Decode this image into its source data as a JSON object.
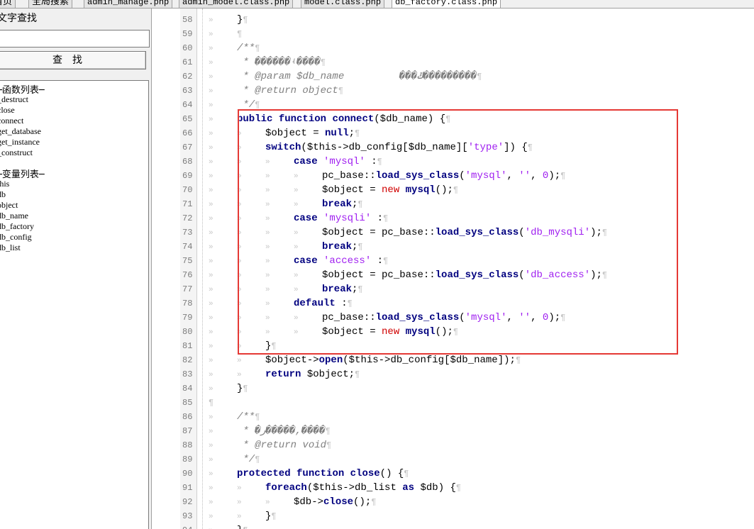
{
  "tabs": [
    {
      "label": "首页"
    },
    {
      "label": "全局搜索"
    },
    {
      "label": "admin_manage.php"
    },
    {
      "label": "admin_model.class.php"
    },
    {
      "label": "model.class.php"
    },
    {
      "label": "db_factory.class.php"
    }
  ],
  "search": {
    "title": "文字查找",
    "placeholder": "",
    "button_label": "查找"
  },
  "functions_header": "函数列表",
  "functions": [
    "_destruct",
    "close",
    "connect",
    "get_database",
    "get_instance",
    "_construct"
  ],
  "variables_header": "变量列表",
  "variables": [
    "this",
    "db",
    "object",
    "db_name",
    "db_factory",
    "db_config",
    "db_list"
  ],
  "line_numbers": [
    "58",
    "59",
    "60",
    "61",
    "62",
    "63",
    "64",
    "65",
    "66",
    "67",
    "68",
    "69",
    "70",
    "71",
    "72",
    "73",
    "74",
    "75",
    "76",
    "77",
    "78",
    "79",
    "80",
    "81",
    "82",
    "83",
    "84",
    "85",
    "86",
    "87",
    "88",
    "89",
    "90",
    "91",
    "92",
    "93",
    "94"
  ],
  "code_lines": [
    "\t}",
    "\t",
    "\t/**",
    "\t * ������ʵ����",
    "\t * @param $db_name \t���ݿ���������",
    "\t * @return object",
    "\t */",
    "\tpublic function connect($db_name) {",
    "\t\t$object = null;",
    "\t\tswitch($this->db_config[$db_name]['type']) {",
    "\t\t\tcase 'mysql' :",
    "\t\t\t\tpc_base::load_sys_class('mysql', '', 0);",
    "\t\t\t\t$object = new mysql();",
    "\t\t\t\tbreak;",
    "\t\t\tcase 'mysqli' :",
    "\t\t\t\t$object = pc_base::load_sys_class('db_mysqli');",
    "\t\t\t\tbreak;",
    "\t\t\tcase 'access' :",
    "\t\t\t\t$object = pc_base::load_sys_class('db_access');",
    "\t\t\t\tbreak;",
    "\t\t\tdefault :",
    "\t\t\t\tpc_base::load_sys_class('mysql', '', 0);",
    "\t\t\t\t$object = new mysql();",
    "\t\t}",
    "\t\t$object->open($this->db_config[$db_name]);",
    "\t\treturn $object;",
    "\t}",
    "",
    "\t/**",
    "\t * �ر�����,����",
    "\t * @return void",
    "\t */",
    "\tprotected function close() {",
    "\t\tforeach($this->db_list as $db) {",
    "\t\t\t$db->close();",
    "\t\t}",
    "\t}"
  ],
  "colors": {
    "keyword": "#000080",
    "string": "#a020f0",
    "comment": "#808080",
    "new_keyword": "#d00000",
    "highlight_border": "#e53935"
  }
}
